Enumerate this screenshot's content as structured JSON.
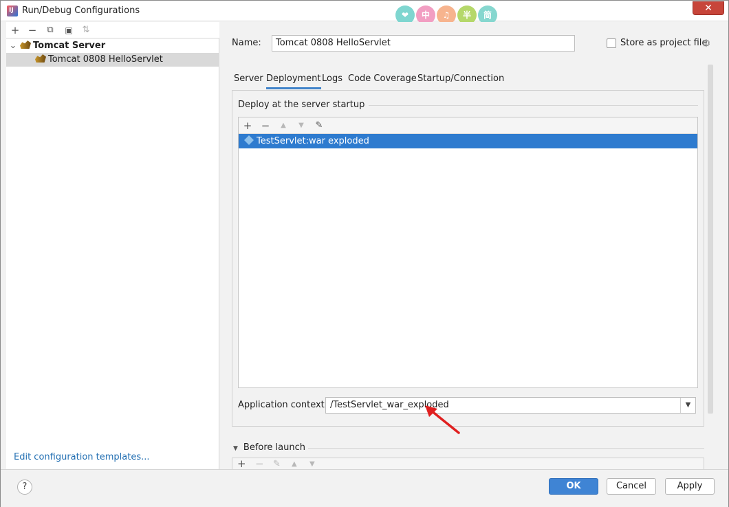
{
  "window": {
    "title": "Run/Debug Configurations",
    "close_label": "✕",
    "badges": [
      "❤",
      "中",
      "♫",
      "半",
      "简"
    ],
    "badge_colors": [
      "#7fd6d0",
      "#f29ec2",
      "#f7b48e",
      "#b5d86a",
      "#86d7cf"
    ]
  },
  "left": {
    "toolbar_icons": [
      "add-icon",
      "remove-icon",
      "copy-icon",
      "folder-add-icon",
      "sort-icon"
    ],
    "toolbar_glyphs": [
      "+",
      "−",
      "⧉",
      "▣",
      "⇅"
    ],
    "tree": {
      "group_expand": "⌄",
      "group_label": "Tomcat Server",
      "child_label": "Tomcat 0808 HelloServlet"
    },
    "edit_templates": "Edit configuration templates..."
  },
  "right": {
    "name_label": "Name:",
    "name_value": "Tomcat 0808 HelloServlet",
    "store_label": "Store as project file",
    "store_checked": false,
    "tabs": [
      "Server",
      "Deployment",
      "Logs",
      "Code Coverage",
      "Startup/Connection"
    ],
    "active_tab": "Deployment",
    "deploy_title": "Deploy at the server startup",
    "list_toolbar_glyphs": [
      "+",
      "−",
      "▲",
      "▼",
      "✎"
    ],
    "artifacts": [
      "TestServlet:war exploded"
    ],
    "app_context_label": "Application context:",
    "app_context_value": "/TestServlet_war_exploded",
    "before_launch_title": "Before launch",
    "before_launch_glyphs": [
      "+",
      "−",
      "✎",
      "▲",
      "▼"
    ]
  },
  "footer": {
    "help": "?",
    "ok": "OK",
    "cancel": "Cancel",
    "apply": "Apply"
  },
  "colors": {
    "selection": "#2e7bcf",
    "primary_button": "#3f84d4",
    "link": "#2470b3",
    "annotation_arrow": "#e02020"
  }
}
